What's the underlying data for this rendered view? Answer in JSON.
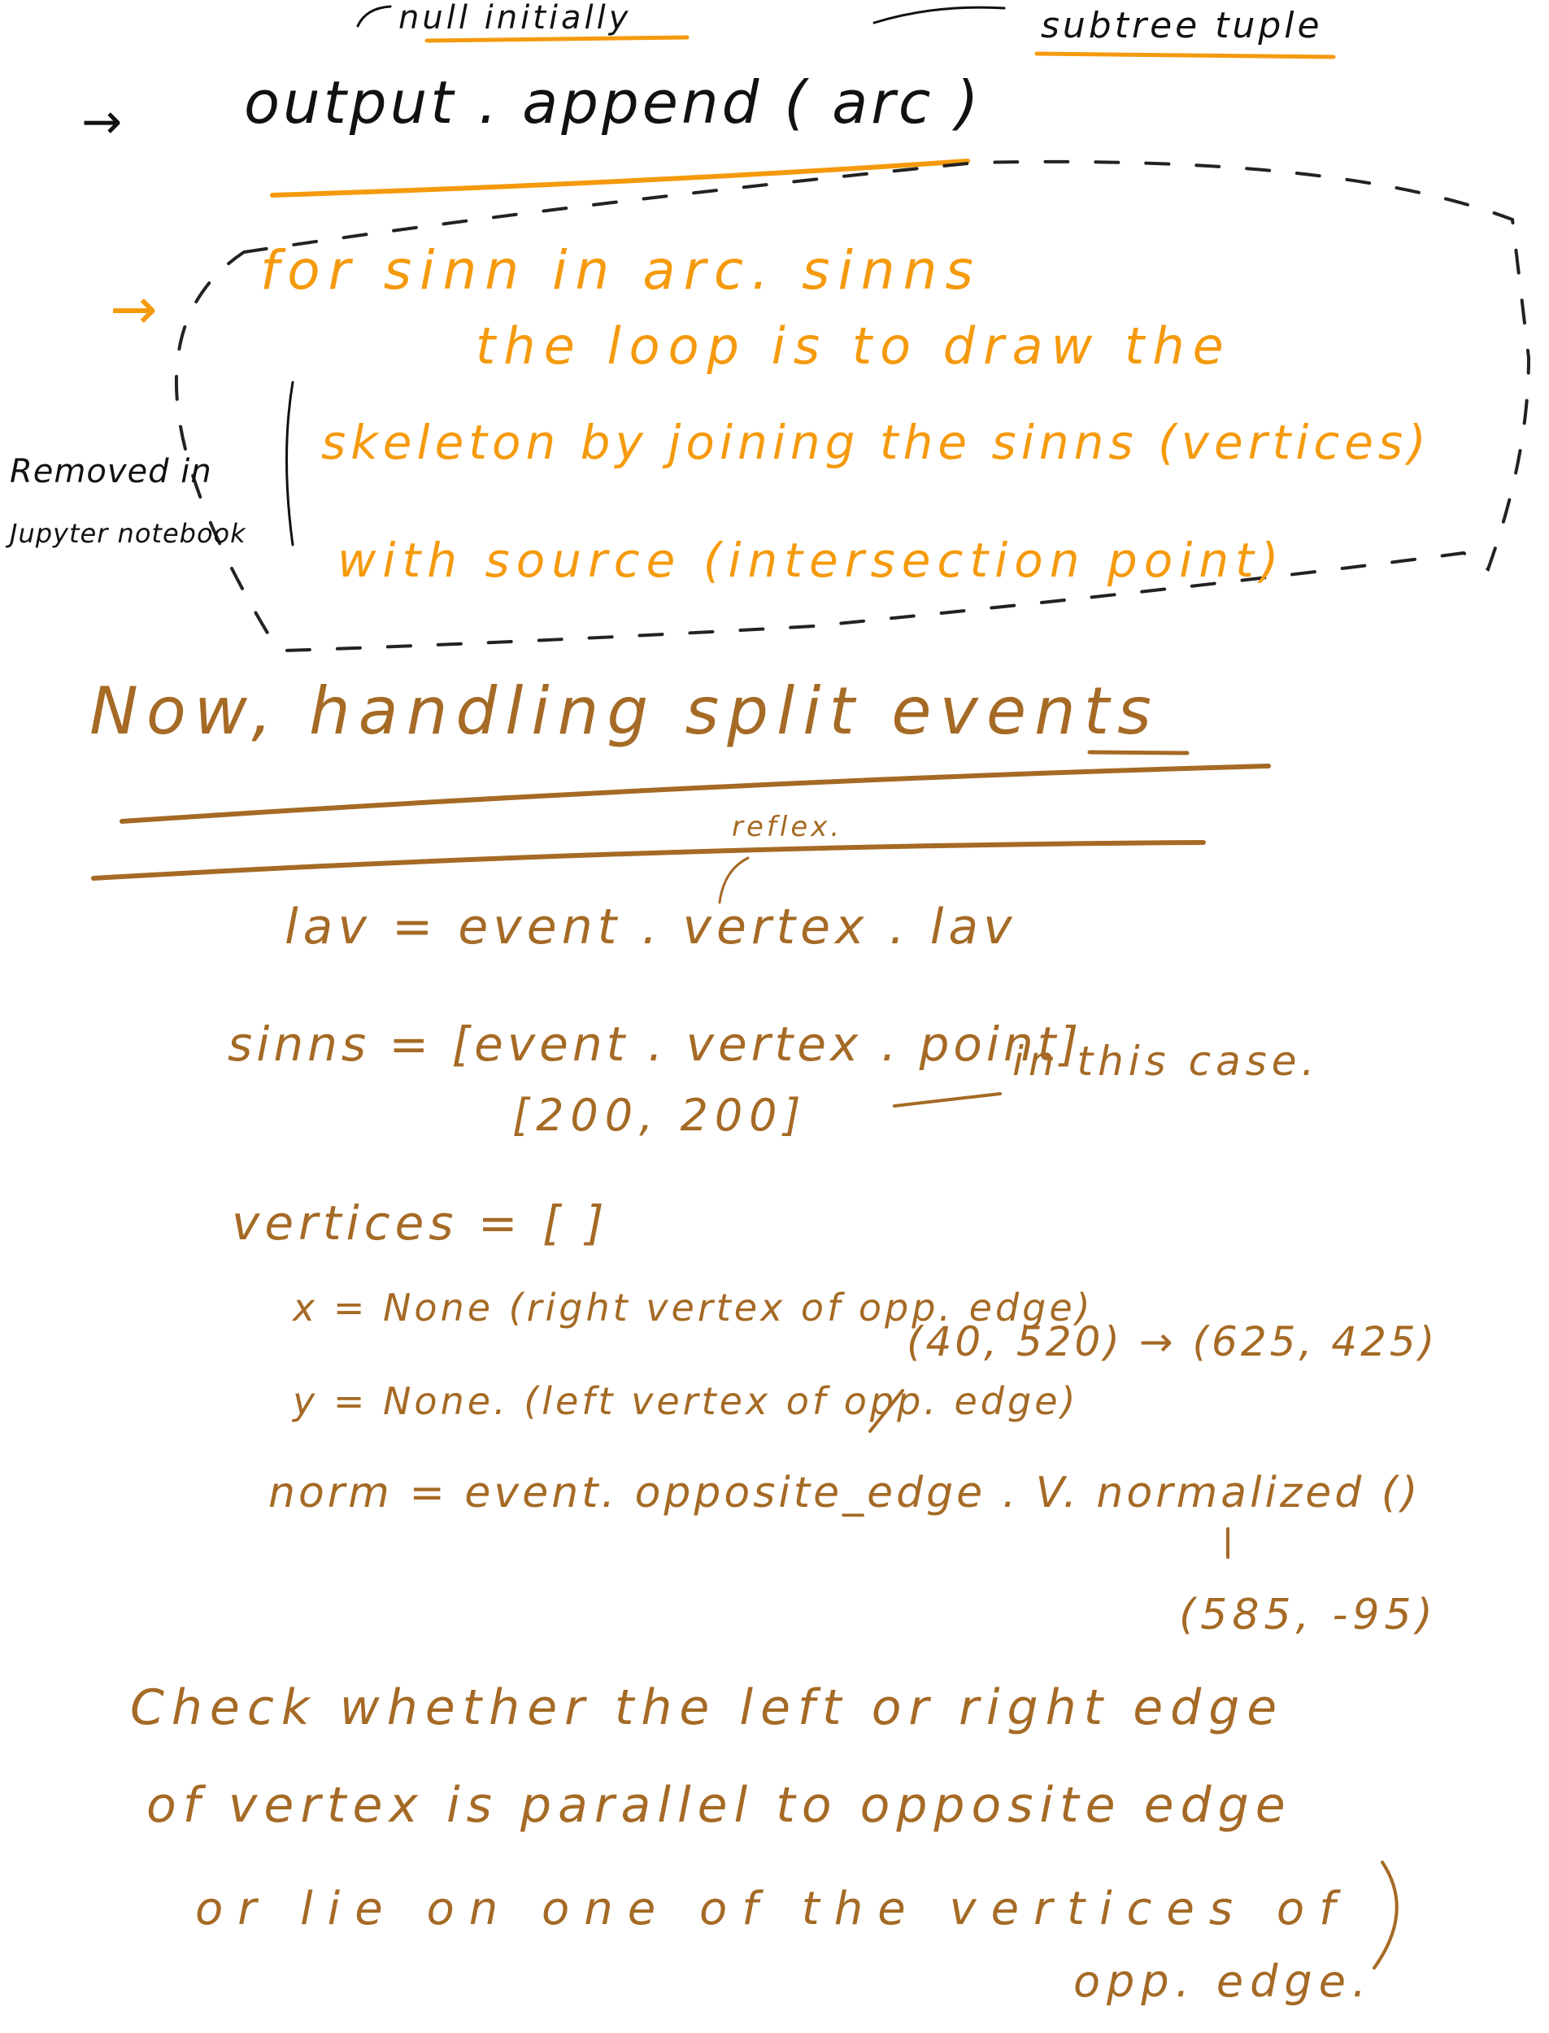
{
  "colors": {
    "black_ink": "#111111",
    "orange_ink": "#f59a0d",
    "brown_ink": "#a56a25",
    "background": "#ffffff"
  },
  "top_section": {
    "null_label": "null initially",
    "subtree_label": "subtree tuple",
    "arrow": "→",
    "code_line": "output . append ( arc )"
  },
  "loop_section": {
    "arrow": "→",
    "line1": "for sinn in arc. sinns",
    "line2": "the loop is to draw the",
    "line3": "skeleton by joining the sinns (vertices)",
    "line4": "with source (intersection point)",
    "side_note_line1": "Removed in",
    "side_note_line2": "Jupyter notebook"
  },
  "split_section": {
    "heading": "Now, handling split events",
    "reflex_note": "reflex.",
    "lav_line": "lav = event . vertex . lav",
    "sinns_line": "sinns = [event . vertex . point]",
    "in_this_case": "in this case.",
    "sinns_value": "[200, 200]",
    "vertices_line": "vertices = [ ]",
    "x_line": "x = None (right vertex of opp. edge)",
    "y_line": "y = None. (left vertex of opp. edge)",
    "opp_edge_points": "(40, 520) → (625, 425)",
    "norm_line": "norm = event. opposite_edge . V. normalized ()",
    "norm_value": "(585, -95)",
    "check_line1": "Check whether the left or right edge",
    "check_line2": "of vertex is parallel to opposite edge",
    "check_line3": "or lie on one of the vertices of",
    "check_line4": "opp. edge."
  }
}
